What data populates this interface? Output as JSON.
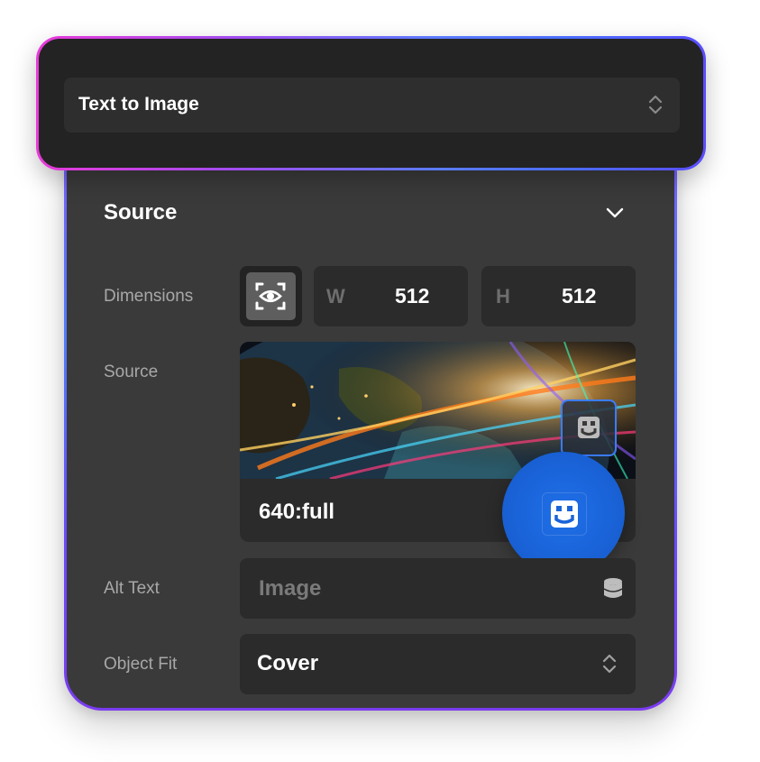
{
  "mode_select": {
    "value": "Text to Image"
  },
  "section": {
    "title": "Source"
  },
  "dimensions": {
    "label": "Dimensions",
    "width_prefix": "W",
    "width_value": "512",
    "height_prefix": "H",
    "height_value": "512"
  },
  "source": {
    "label": "Source",
    "value": "640:full"
  },
  "alt_text": {
    "label": "Alt Text",
    "placeholder": "Image"
  },
  "object_fit": {
    "label": "Object Fit",
    "value": "Cover"
  },
  "colors": {
    "panel_bg": "#3a3a3a",
    "field_bg": "#2b2b2b",
    "accent_blue": "#1f6fe8",
    "gradient_pink": "#e83ad8",
    "gradient_blue": "#4f7dff"
  },
  "icons": {
    "mode_select": "chevron-updown-icon",
    "section_toggle": "chevron-down-icon",
    "aspect_lock": "aspect-eye-icon",
    "dynamic_data": "database-icon",
    "drag_handle": "drag-drop-icon"
  }
}
